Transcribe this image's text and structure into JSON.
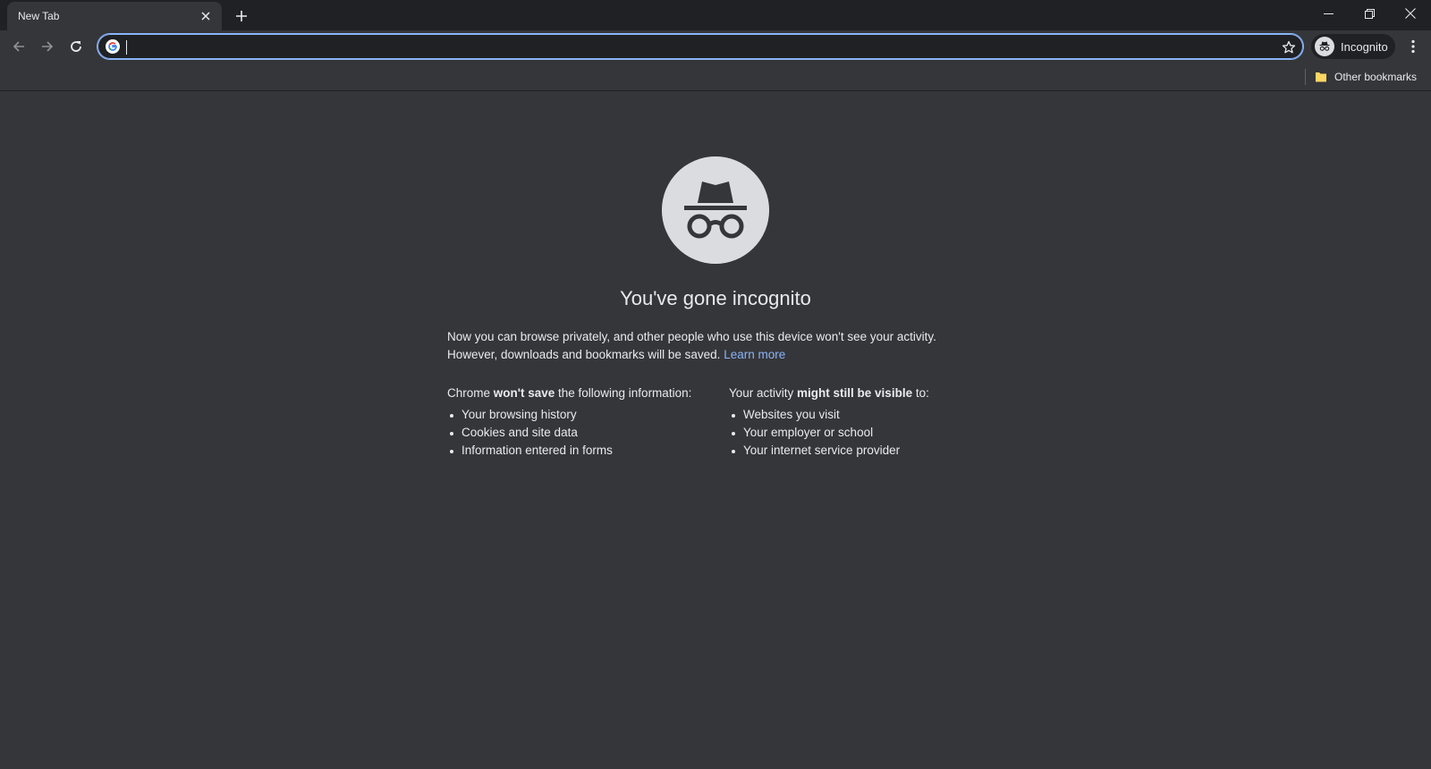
{
  "tabstrip": {
    "tab_title": "New Tab",
    "tab_close_icon": "close-icon",
    "new_tab_icon": "plus-icon"
  },
  "window_controls": [
    "minimize-icon",
    "restore-icon",
    "close-icon"
  ],
  "toolbar": {
    "back_icon": "arrow-left-icon",
    "forward_icon": "arrow-right-icon",
    "reload_icon": "reload-icon",
    "omnibox": {
      "value": "",
      "placeholder": "",
      "leading_icon": "google-g-icon",
      "bookmark_icon": "star-icon"
    },
    "profile": {
      "label": "Incognito",
      "icon": "incognito-icon"
    },
    "menu_icon": "kebab-menu-icon"
  },
  "bookmarks_bar": {
    "other_bookmarks": "Other bookmarks",
    "folder_icon": "folder-icon"
  },
  "content": {
    "icon": "incognito-icon",
    "headline": "You've gone incognito",
    "intro_line1": "Now you can browse privately, and other people who use this device won't see your activity.",
    "intro_line2": "However, downloads and bookmarks will be saved.",
    "learn_more": "Learn more",
    "left_heading_prefix": "Chrome ",
    "left_heading_bold": "won't save",
    "left_heading_suffix": " the following information:",
    "left_items": [
      "Your browsing history",
      "Cookies and site data",
      "Information entered in forms"
    ],
    "right_heading_prefix": "Your activity ",
    "right_heading_bold": "might still be visible",
    "right_heading_suffix": " to:",
    "right_items": [
      "Websites you visit",
      "Your employer or school",
      "Your internet service provider"
    ]
  },
  "colors": {
    "frame": "#202124",
    "toolbar": "#35363a",
    "text": "#e8eaed",
    "link": "#8ab4f8",
    "icon_bg": "#dadce0",
    "bookmark_folder": "#fdd663"
  }
}
